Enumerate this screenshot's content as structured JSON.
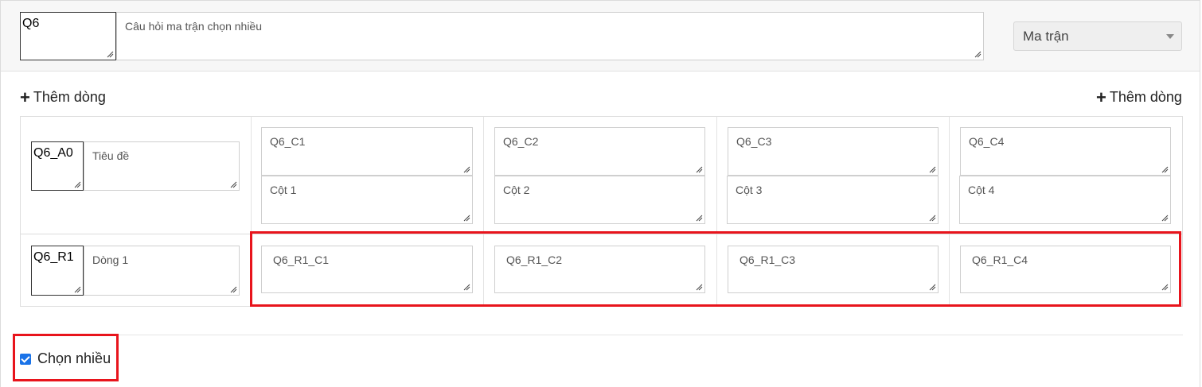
{
  "question": {
    "code": "Q6",
    "text": "Câu hỏi ma trận chọn nhiều",
    "type_selected": "Ma trận"
  },
  "add_row_label": "Thêm dòng",
  "header_row": {
    "code": "Q6_A0",
    "label": "Tiêu đề"
  },
  "columns": [
    {
      "code": "Q6_C1",
      "label": "Cột 1"
    },
    {
      "code": "Q6_C2",
      "label": "Cột 2"
    },
    {
      "code": "Q6_C3",
      "label": "Cột 3"
    },
    {
      "code": "Q6_C4",
      "label": "Cột 4"
    }
  ],
  "rows": [
    {
      "code": "Q6_R1",
      "label": "Dòng 1",
      "cells": [
        "Q6_R1_C1",
        "Q6_R1_C2",
        "Q6_R1_C3",
        "Q6_R1_C4"
      ]
    }
  ],
  "multi_select": {
    "label": "Chọn nhiều",
    "checked": true
  },
  "colors": {
    "highlight": "#e8141c",
    "checkbox": "#1a73e8",
    "header_bg": "#f7f7f7"
  }
}
